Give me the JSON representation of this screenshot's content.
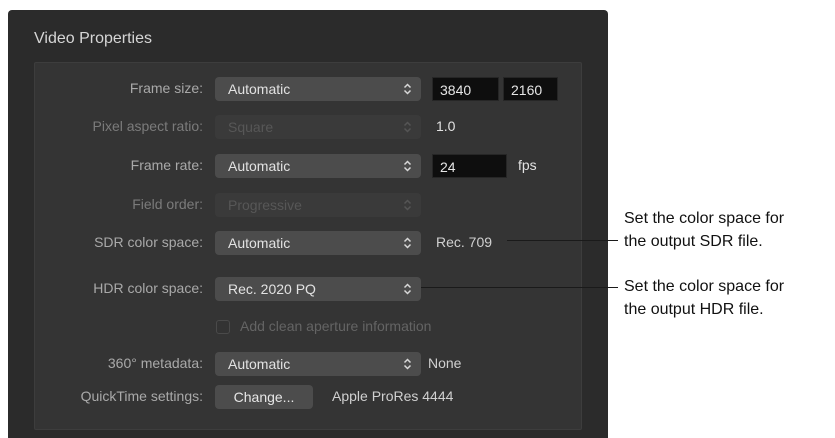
{
  "panel": {
    "title": "Video Properties"
  },
  "rows": {
    "frame_size": {
      "label": "Frame size:",
      "value": "Automatic",
      "width": "3840",
      "height": "2160"
    },
    "pixel_aspect": {
      "label": "Pixel aspect ratio:",
      "value": "Square",
      "readout": "1.0"
    },
    "frame_rate": {
      "label": "Frame rate:",
      "value": "Automatic",
      "fps_value": "24",
      "fps_unit": "fps"
    },
    "field_order": {
      "label": "Field order:",
      "value": "Progressive"
    },
    "sdr": {
      "label": "SDR color space:",
      "value": "Automatic",
      "readout": "Rec. 709"
    },
    "hdr": {
      "label": "HDR color space:",
      "value": "Rec. 2020 PQ"
    },
    "clean_aperture": {
      "label": "Add clean aperture information",
      "checked": false
    },
    "metadata_360": {
      "label": "360° metadata:",
      "value": "Automatic",
      "readout": "None"
    },
    "quicktime": {
      "label": "QuickTime settings:",
      "button": "Change...",
      "readout": "Apple ProRes 4444"
    }
  },
  "callouts": {
    "sdr": {
      "line1": "Set the color space for",
      "line2": "the output SDR file."
    },
    "hdr": {
      "line1": "Set the color space for",
      "line2": "the output HDR file."
    }
  },
  "icons": {
    "popup_arrows": "up-down-chevron-icon"
  },
  "colors": {
    "panel_bg": "#2b2b2b",
    "inner_bg": "#343434",
    "control_bg": "#4c4c4c",
    "field_bg": "#0e0e0e"
  }
}
